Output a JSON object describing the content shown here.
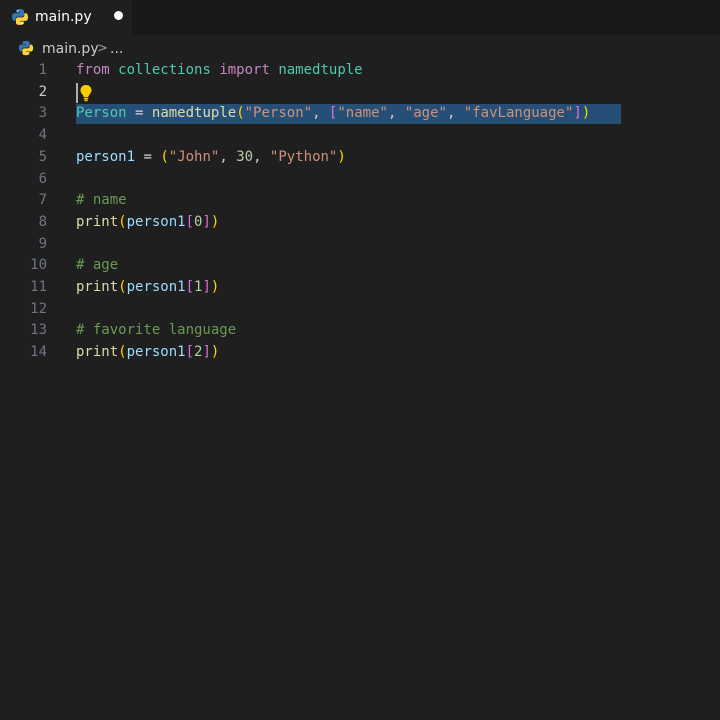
{
  "tab": {
    "file_name": "main.py",
    "dirty": true
  },
  "breadcrumb": {
    "file": "main.py",
    "separator": ">",
    "more": "..."
  },
  "editor": {
    "active_line": 2,
    "selected_line": 3,
    "lines": [
      {
        "number": "1",
        "text": "from collections import namedtuple"
      },
      {
        "number": "2",
        "text": ""
      },
      {
        "number": "3",
        "text": "Person = namedtuple(\"Person\", [\"name\", \"age\", \"favLanguage\"])"
      },
      {
        "number": "4",
        "text": ""
      },
      {
        "number": "5",
        "text": "person1 = (\"John\", 30, \"Python\")"
      },
      {
        "number": "6",
        "text": ""
      },
      {
        "number": "7",
        "text": "# name"
      },
      {
        "number": "8",
        "text": "print(person1[0])"
      },
      {
        "number": "9",
        "text": ""
      },
      {
        "number": "10",
        "text": "# age"
      },
      {
        "number": "11",
        "text": "print(person1[1])"
      },
      {
        "number": "12",
        "text": ""
      },
      {
        "number": "13",
        "text": "# favorite language"
      },
      {
        "number": "14",
        "text": "print(person1[2])"
      }
    ]
  },
  "icons": {
    "tab_icon": "python-icon",
    "breadcrumb_icon": "python-icon",
    "lightbulb": "lightbulb-icon"
  },
  "colors": {
    "background": "#1f1f1f",
    "selection": "#264f78",
    "keyword": "#c586c0",
    "string": "#ce9178",
    "comment": "#6a9955",
    "number": "#b5cea8",
    "function": "#dcdcaa",
    "variable": "#9cdcfe"
  }
}
